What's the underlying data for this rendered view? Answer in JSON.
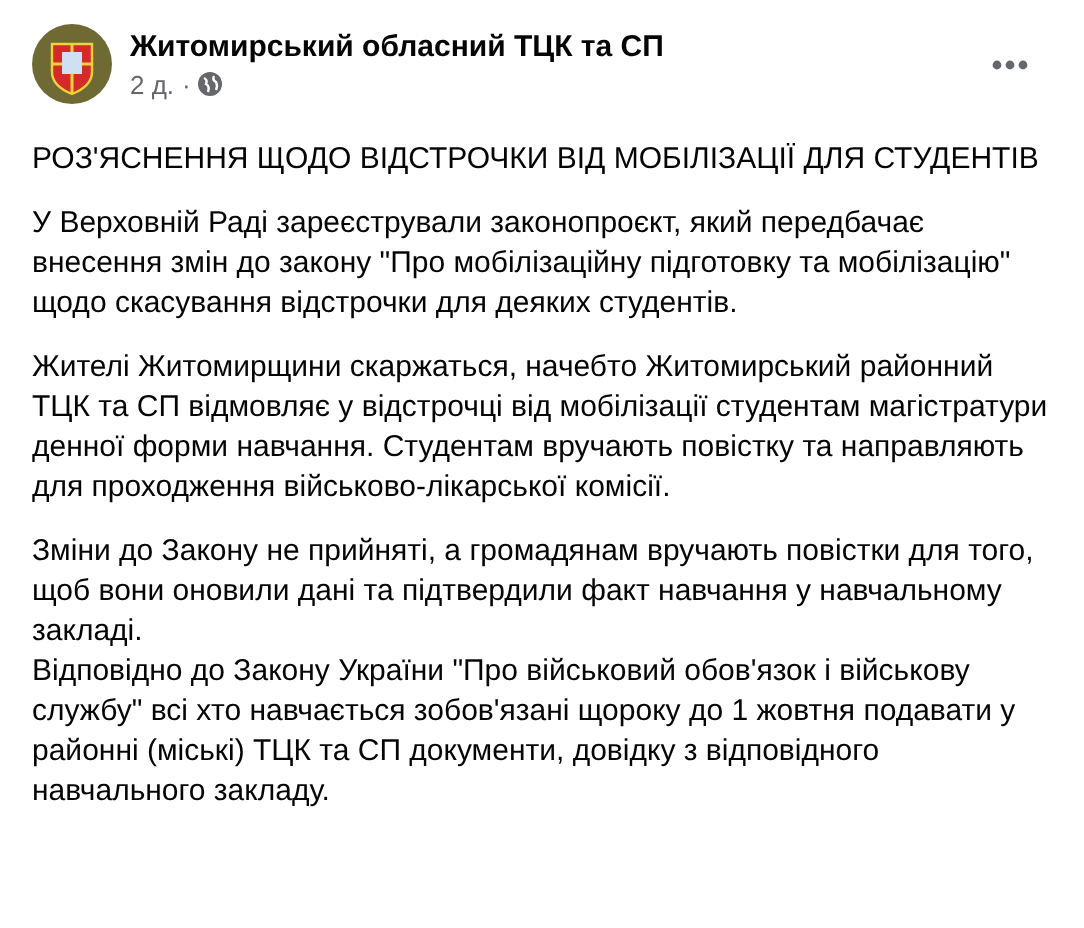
{
  "post": {
    "author": "Житомирський обласний ТЦК та СП",
    "time": "2 д.",
    "separator": "·",
    "heading": "РОЗ'ЯСНЕННЯ ЩОДО ВІДСТРОЧКИ ВІД МОБІЛІЗАЦІЇ ДЛЯ СТУДЕНТІВ",
    "paragraphs": [
      [
        "У Верховній Раді зареєстрували законопроєкт, який передбачає внесення змін до закону \"Про мобілізаційну підготовку та мобілізацію\" щодо скасування відстрочки для деяких студентів."
      ],
      [
        "Жителі Житомирщини скаржаться, начебто  Житомирський районний ТЦК та СП відмовляє у відстрочці від мобілізації студентам магістратури денної форми навчання. Студентам вручають повістку та направляють для проходження військово-лікарської комісії."
      ],
      [
        "Зміни до Закону не прийняті, а громадянам вручають повістки для того, щоб вони оновили дані та підтвердили факт навчання у навчальному закладі.",
        "Відповідно до Закону України \"Про військовий обов'язок і військову службу\" всі хто навчається зобов'язані щороку до 1 жовтня подавати у районні (міські) ТЦК та СП документи, довідку з відповідного навчального закладу."
      ]
    ]
  }
}
